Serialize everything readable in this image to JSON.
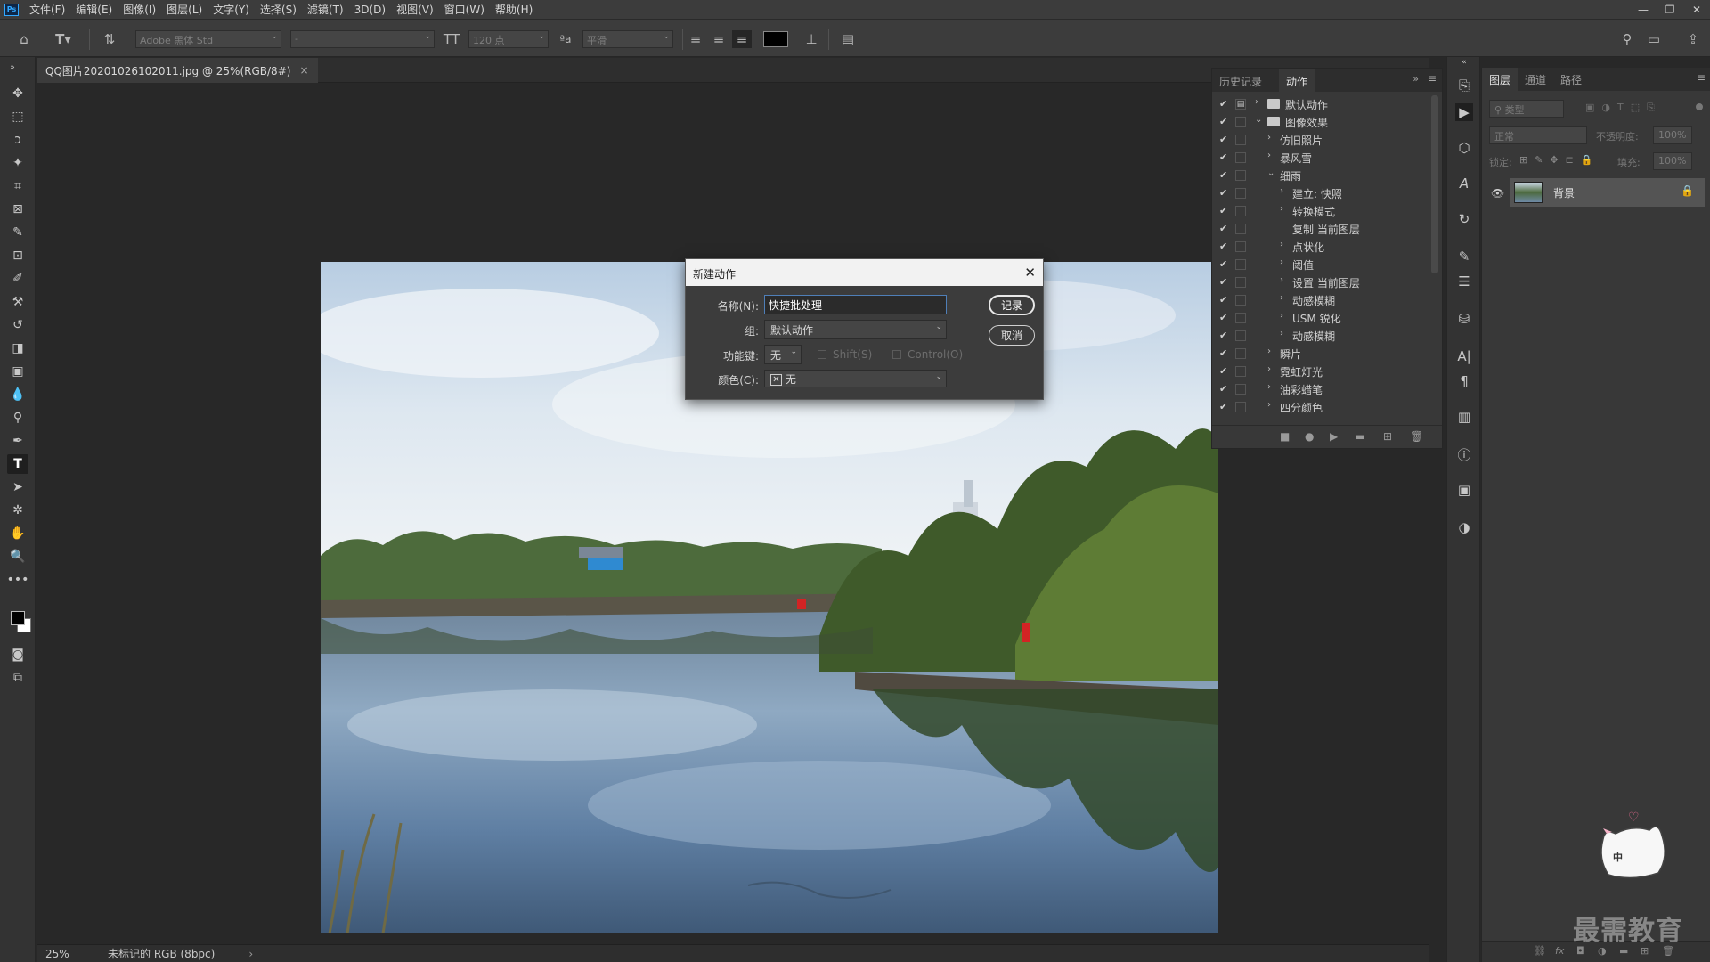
{
  "app": {
    "logo_text": "Ps"
  },
  "menu": [
    "文件(F)",
    "编辑(E)",
    "图像(I)",
    "图层(L)",
    "文字(Y)",
    "选择(S)",
    "滤镜(T)",
    "3D(D)",
    "视图(V)",
    "窗口(W)",
    "帮助(H)"
  ],
  "window_controls": [
    "—",
    "❐",
    "✕"
  ],
  "options_bar": {
    "font_family": "Adobe 黑体 Std",
    "font_style": "-",
    "font_size": "120 点",
    "aa_icon_text": "ªa",
    "antialias": "平滑",
    "text_color": "#000000"
  },
  "document": {
    "tab_title": "QQ图片20201026102011.jpg @ 25%(RGB/8#)",
    "tab_close": "×"
  },
  "status": {
    "zoom": "25%",
    "profile": "未标记的 RGB (8bpc)",
    "arrow": "›"
  },
  "dialog": {
    "title": "新建动作",
    "close": "✕",
    "name_label": "名称(N):",
    "name_value": "快捷批处理",
    "group_label": "组:",
    "group_value": "默认动作",
    "fkey_label": "功能键:",
    "fkey_value": "无",
    "shift_label": "Shift(S)",
    "control_label": "Control(O)",
    "color_label": "颜色(C):",
    "color_value": "无",
    "color_x": "✕",
    "record_button": "记录",
    "cancel_button": "取消"
  },
  "actions_panel": {
    "tabs": [
      "历史记录",
      "动作"
    ],
    "active_tab": "动作",
    "rows": [
      {
        "label": "默认动作",
        "level": 0,
        "expanded": false,
        "folder": true,
        "dialog_box": true
      },
      {
        "label": "图像效果",
        "level": 0,
        "expanded": true,
        "folder": true
      },
      {
        "label": "仿旧照片",
        "level": 1,
        "expanded": false
      },
      {
        "label": "暴风雪",
        "level": 1,
        "expanded": false
      },
      {
        "label": "细雨",
        "level": 1,
        "expanded": true
      },
      {
        "label": "建立: 快照",
        "level": 2,
        "expanded": false
      },
      {
        "label": "转换模式",
        "level": 2,
        "expanded": false
      },
      {
        "label": "复制 当前图层",
        "level": 2,
        "no_arrow": true
      },
      {
        "label": "点状化",
        "level": 2,
        "expanded": false
      },
      {
        "label": "阈值",
        "level": 2,
        "expanded": false
      },
      {
        "label": "设置 当前图层",
        "level": 2,
        "expanded": false
      },
      {
        "label": "动感模糊",
        "level": 2,
        "expanded": false
      },
      {
        "label": "USM 锐化",
        "level": 2,
        "expanded": false
      },
      {
        "label": "动感模糊",
        "level": 2,
        "expanded": false
      },
      {
        "label": "瞬片",
        "level": 1,
        "expanded": false
      },
      {
        "label": "霓虹灯光",
        "level": 1,
        "expanded": false
      },
      {
        "label": "油彩蜡笔",
        "level": 1,
        "expanded": false
      },
      {
        "label": "四分颜色",
        "level": 1,
        "expanded": false
      }
    ],
    "check": "✔",
    "footer_icons": [
      "■",
      "●",
      "▶",
      "▬",
      "⊞",
      "🗑"
    ]
  },
  "layers_panel": {
    "tabs": [
      "图层",
      "通道",
      "路径"
    ],
    "active_tab": "图层",
    "filter_placeholder": "类型",
    "blend_mode": "正常",
    "opacity_label": "不透明度:",
    "opacity_value": "100%",
    "lock_label": "锁定:",
    "fill_label": "填充:",
    "fill_value": "100%",
    "layer_name": "背景",
    "footer_icons": [
      "⛓",
      "fx",
      "◘",
      "◑",
      "▬",
      "⊞",
      "🗑"
    ]
  },
  "watermark": "最需教育",
  "sticker_text": "中"
}
